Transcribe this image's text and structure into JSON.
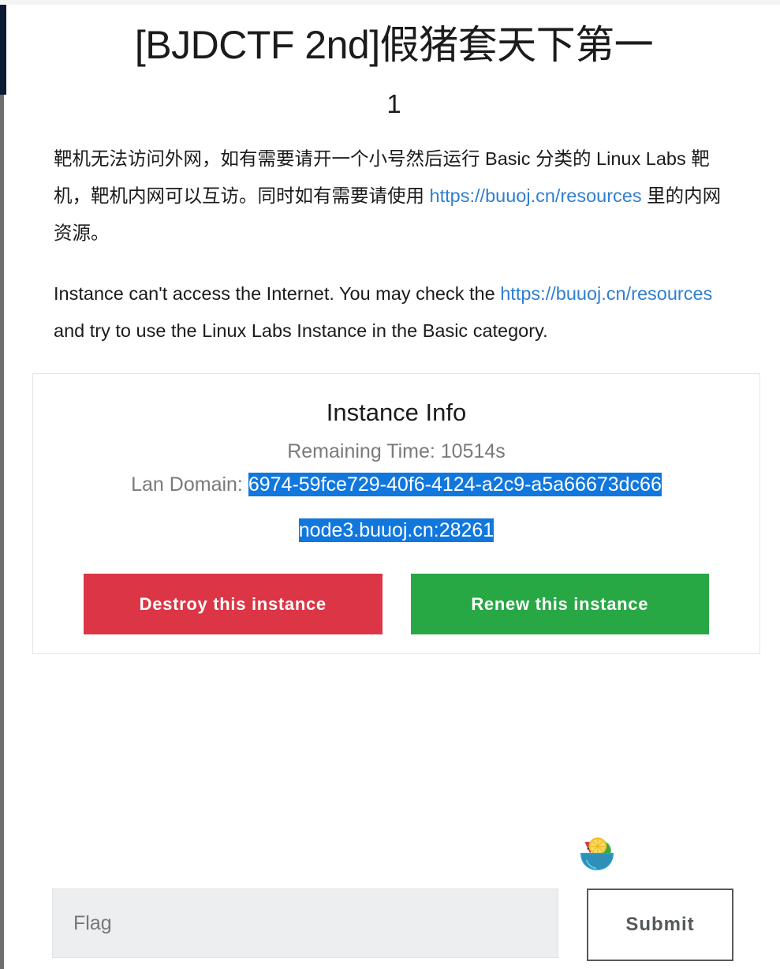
{
  "page": {
    "title": "[BJDCTF 2nd]假猪套天下第一",
    "subtitle": "1"
  },
  "description": {
    "chinese_before_link": "靶机无法访问外网，如有需要请开一个小号然后运行 Basic 分类的 Linux Labs 靶机，靶机内网可以互访。同时如有需要请使用 ",
    "chinese_link": "https://buuoj.cn/resources",
    "chinese_after_link": " 里的内网资源。",
    "english_before_link": "Instance can't access the Internet. You may check the ",
    "english_link": "https://buuoj.cn/resources",
    "english_after_link": " and try to use the Linux Labs Instance in the Basic category."
  },
  "instance": {
    "heading": "Instance Info",
    "remaining_time_label": "Remaining Time: ",
    "remaining_time_value": "10514s",
    "lan_domain_label": "Lan Domain: ",
    "lan_domain_value": "6974-59fce729-40f6-4124-a2c9-a5a66673dc66",
    "address_value": "node3.buuoj.cn:28261",
    "destroy_label": "Destroy this instance",
    "renew_label": "Renew this instance"
  },
  "flag_form": {
    "input_value": "",
    "input_placeholder": "Flag",
    "submit_label": "Submit"
  },
  "colors": {
    "destroy_red": "#dc3545",
    "renew_green": "#28a745",
    "selection_blue": "#1177dd",
    "link_blue": "#2f7fd1",
    "navbar_navy": "#0b1a33",
    "muted_gray": "#7a7a7a"
  }
}
